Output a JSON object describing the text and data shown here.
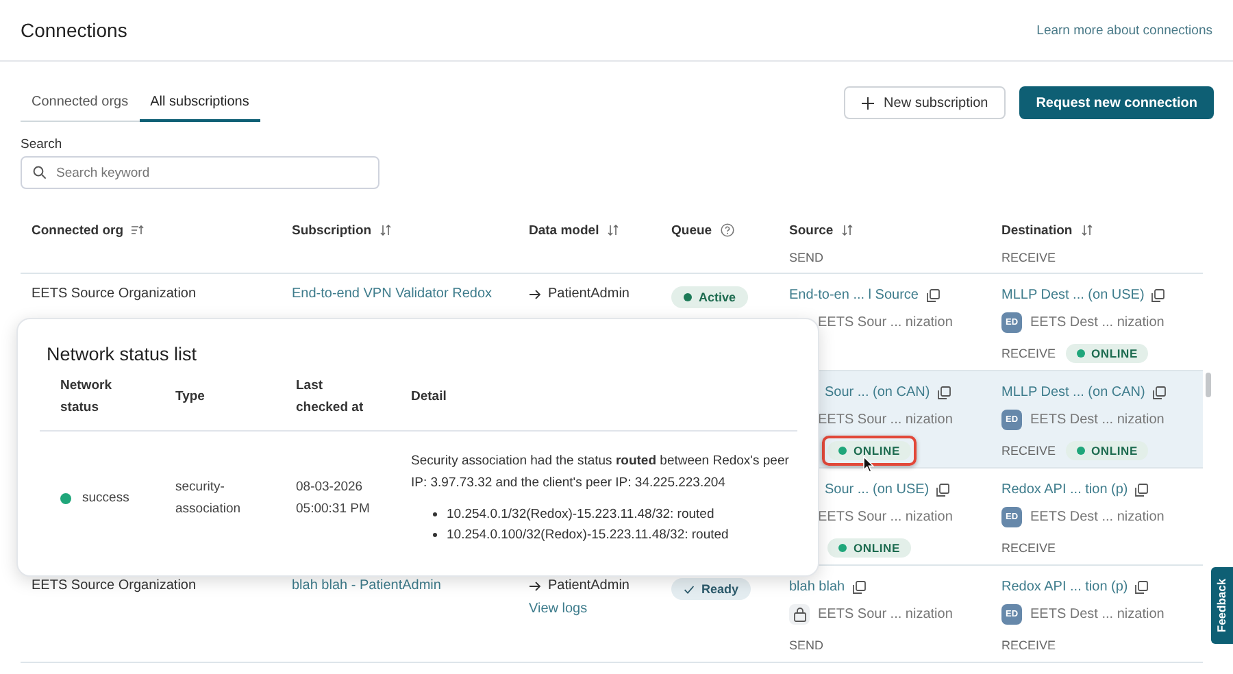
{
  "header": {
    "title": "Connections",
    "help_link": "Learn more about connections"
  },
  "tabs": [
    {
      "label": "Connected orgs",
      "selected": false
    },
    {
      "label": "All subscriptions",
      "selected": true
    }
  ],
  "actions": {
    "secondary": "New subscription",
    "primary": "Request new connection"
  },
  "search": {
    "label": "Search",
    "placeholder": "Search keyword"
  },
  "table": {
    "columns": [
      {
        "label": "Connected org",
        "kind": "sorted"
      },
      {
        "label": "Subscription",
        "kind": "sortable"
      },
      {
        "label": "Data model",
        "kind": "sortable"
      },
      {
        "label": "Queue",
        "kind": "help"
      },
      {
        "label": "Source",
        "kind": "sortable"
      },
      {
        "label": "Destination",
        "kind": "sortable"
      }
    ],
    "partial_row": {
      "source": "SEND",
      "destination": "RECEIVE"
    },
    "rows": [
      {
        "kind": "full",
        "selected": false,
        "org": "EETS Source Organization",
        "subscription": "End-to-end VPN Validator Redox",
        "data_model": "PatientAdmin",
        "queue": {
          "label": "Active",
          "kind": "active"
        },
        "source": {
          "name": "End-to-en ... l Source",
          "org": "EETS Sour ... nization"
        },
        "destination": {
          "name": "MLLP Dest ... (on USE)",
          "avatar": "ED",
          "org": "EETS Dest ... nization",
          "direction": "RECEIVE",
          "status": {
            "label": "ONLINE",
            "highlighted": false
          }
        }
      },
      {
        "kind": "partial",
        "selected": true,
        "source": {
          "name": "Sour ... (on CAN)",
          "org": "EETS Sour ... nization",
          "status": {
            "label": "ONLINE",
            "highlighted": true
          }
        },
        "destination": {
          "name": "MLLP Dest ... (on CAN)",
          "avatar": "ED",
          "org": "EETS Dest ... nization",
          "direction": "RECEIVE",
          "status": {
            "label": "ONLINE",
            "highlighted": false
          }
        }
      },
      {
        "kind": "partial",
        "selected": false,
        "source": {
          "name": "Sour ... (on USE)",
          "org": "EETS Sour ... nization",
          "status": {
            "label": "ONLINE",
            "highlighted": false
          }
        },
        "destination": {
          "name": "Redox API ... tion (p)",
          "avatar": "ED",
          "org": "EETS Dest ... nization",
          "direction": "RECEIVE"
        }
      },
      {
        "kind": "full",
        "selected": false,
        "org": "EETS Source Organization",
        "subscription": "blah blah - PatientAdmin",
        "data_model": "PatientAdmin",
        "view_logs": "View logs",
        "queue": {
          "label": "Ready",
          "kind": "ready"
        },
        "source": {
          "name": "blah blah",
          "locked": true,
          "org": "EETS Sour ... nization",
          "direction": "SEND"
        },
        "destination": {
          "name": "Redox API ... tion (p)",
          "avatar": "ED",
          "org": "EETS Dest ... nization",
          "direction": "RECEIVE"
        }
      }
    ]
  },
  "popover": {
    "title": "Network status list",
    "columns": [
      "Network status",
      "Type",
      "Last checked at",
      "Detail"
    ],
    "rows": [
      {
        "status": {
          "label": "success",
          "kind": "success"
        },
        "type": "security-association",
        "checked": "08-03-2026 05:00:31 PM",
        "detail": "Security association had the status **routed** between Redox's peer IP: 3.97.73.32 and the client's peer IP: 34.225.223.204",
        "routes": [
          "10.254.0.1/32(Redox)-15.223.11.48/32: routed",
          "10.254.0.100/32(Redox)-15.223.11.48/32: routed"
        ]
      }
    ]
  },
  "feedback": "Feedback"
}
